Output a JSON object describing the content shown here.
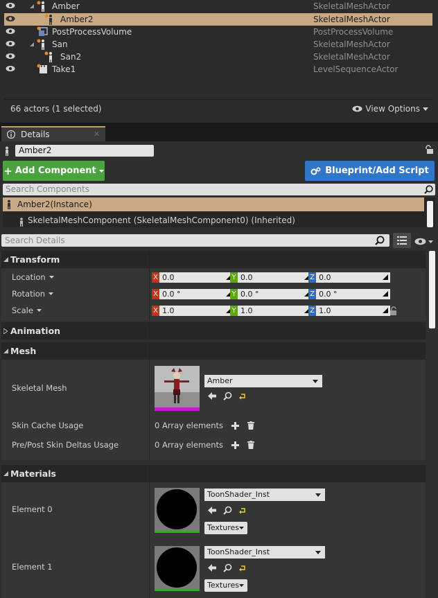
{
  "outliner": {
    "rows": [
      {
        "name": "Amber",
        "type": "SkeletalMeshActor"
      },
      {
        "name": "Amber2",
        "type": "SkeletalMeshActor"
      },
      {
        "name": "PostProcessVolume",
        "type": "PostProcessVolume"
      },
      {
        "name": "San",
        "type": "SkeletalMeshActor"
      },
      {
        "name": "San2",
        "type": "SkeletalMeshActor"
      },
      {
        "name": "Take1",
        "type": "LevelSequenceActor"
      }
    ],
    "actor_count": "66 actors (1 selected)",
    "view_options": "View Options"
  },
  "tab": {
    "label": "Details"
  },
  "details": {
    "name_value": "Amber2",
    "add_component": "Add Component",
    "blueprint_button": "Blueprint/Add Script",
    "search_components_placeholder": "Search Components",
    "instance_label": "Amber2(Instance)",
    "component_label": "SkeletalMeshComponent (SkeletalMeshComponent0) (Inherited)",
    "search_details_placeholder": "Search Details"
  },
  "transform": {
    "title": "Transform",
    "location": {
      "label": "Location",
      "x": "0.0",
      "y": "0.0",
      "z": "0.0"
    },
    "rotation": {
      "label": "Rotation",
      "x": "0.0 °",
      "y": "0.0 °",
      "z": "0.0 °"
    },
    "scale": {
      "label": "Scale",
      "x": "1.0",
      "y": "1.0",
      "z": "1.0"
    }
  },
  "axes": {
    "x": "X",
    "y": "Y",
    "z": "Z"
  },
  "animation": {
    "title": "Animation"
  },
  "mesh": {
    "title": "Mesh",
    "skeletal_mesh_label": "Skeletal Mesh",
    "skeletal_mesh_value": "Amber",
    "skin_cache_label": "Skin Cache Usage",
    "skin_cache_value": "0 Array elements",
    "skin_deltas_label": "Pre/Post Skin Deltas Usage",
    "skin_deltas_value": "0 Array elements"
  },
  "materials": {
    "title": "Materials",
    "elements": [
      {
        "label": "Element 0",
        "value": "ToonShader_Inst",
        "textures": "Textures"
      },
      {
        "label": "Element 1",
        "value": "ToonShader_Inst",
        "textures": "Textures"
      }
    ]
  },
  "colors": {
    "selection": "#c9a984",
    "add_component": "#4aa33f",
    "blueprint": "#3276c7",
    "axis_x": "#c8321c",
    "axis_y": "#5fa61a",
    "axis_z": "#2c6acb"
  }
}
